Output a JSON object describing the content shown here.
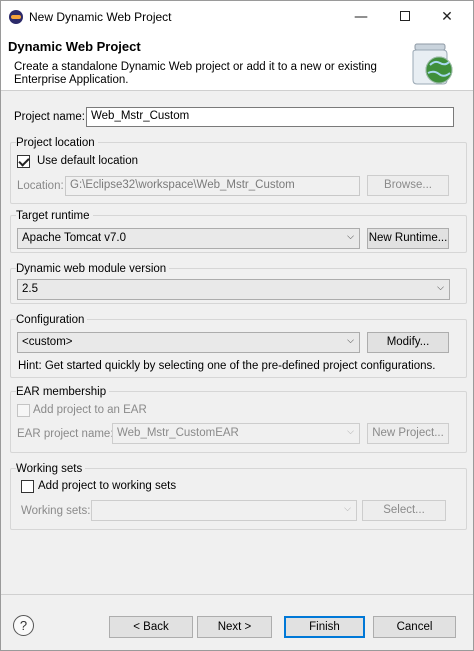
{
  "window": {
    "title": "New Dynamic Web Project",
    "minimize_glyph": "—",
    "close_glyph": "✕"
  },
  "banner": {
    "title": "Dynamic Web Project",
    "description": "Create a standalone Dynamic Web project or add it to a new or existing Enterprise Application."
  },
  "project_name": {
    "label": "Project name:",
    "value": "Web_Mstr_Custom"
  },
  "project_location": {
    "title": "Project location",
    "use_default_label": "Use default location",
    "use_default_checked": true,
    "location_label": "Location:",
    "location_value": "G:\\Eclipse32\\workspace\\Web_Mstr_Custom",
    "browse_label": "Browse..."
  },
  "target_runtime": {
    "title": "Target runtime",
    "selected": "Apache Tomcat v7.0",
    "new_runtime_label": "New Runtime..."
  },
  "module_version": {
    "title": "Dynamic web module version",
    "selected": "2.5"
  },
  "configuration": {
    "title": "Configuration",
    "selected": "<custom>",
    "modify_label": "Modify...",
    "hint": "Hint: Get started quickly by selecting one of the pre-defined project configurations."
  },
  "ear_membership": {
    "title": "EAR membership",
    "add_label": "Add project to an EAR",
    "add_checked": false,
    "ear_name_label": "EAR project name:",
    "ear_name_value": "Web_Mstr_CustomEAR",
    "new_project_label": "New Project..."
  },
  "working_sets": {
    "title": "Working sets",
    "add_label": "Add project to working sets",
    "add_checked": false,
    "sets_label": "Working sets:",
    "sets_value": "",
    "select_label": "Select..."
  },
  "footer": {
    "help_glyph": "?",
    "back_label": "< Back",
    "next_label": "Next >",
    "finish_label": "Finish",
    "cancel_label": "Cancel"
  },
  "icons": {
    "app": "eclipse-icon",
    "banner": "web-project-jar-icon",
    "dropdown": "chevron-down-icon",
    "help": "help-icon"
  }
}
